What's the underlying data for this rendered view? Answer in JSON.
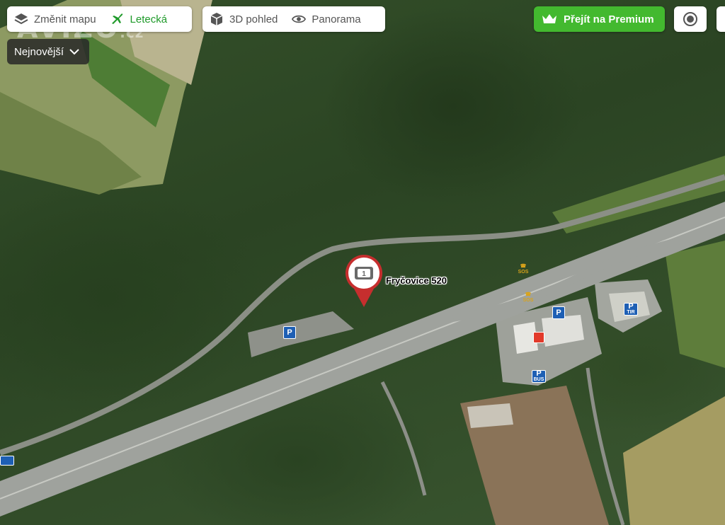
{
  "map_type": {
    "change_label": "Změnit mapu",
    "active_label": "Letecká",
    "active_color": "#1f9a2a"
  },
  "views": {
    "pohled_3d": "3D pohled",
    "panorama": "Panorama"
  },
  "premium": {
    "label": "Přejít na Premium",
    "color": "#43b92f"
  },
  "sort": {
    "label": "Nejnovější"
  },
  "watermark": {
    "brand": "AVIZO",
    "tld": ".cz"
  },
  "marker": {
    "label": "Fryčovice 520",
    "badge": "1",
    "color": "#c62e2e"
  },
  "poi": {
    "parking": "P",
    "tir_top": "P",
    "tir_bottom": "TIR",
    "bus_top": "P",
    "bus_bottom": "BUS",
    "sos": "SOS"
  },
  "icons": {
    "layers": "layers-icon",
    "plane": "plane-icon",
    "cube": "cube-icon",
    "eye": "eye-icon",
    "crown": "crown-icon",
    "target": "target-icon",
    "chevron": "chevron-down-icon"
  }
}
